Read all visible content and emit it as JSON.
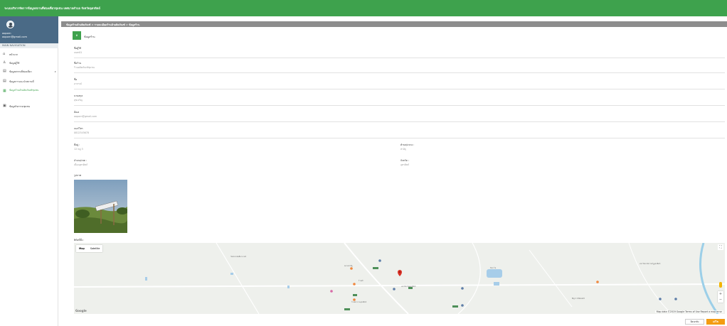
{
  "header": {
    "title": "ระบบบริหารจัดการข้อมูลสถานที่ท่องเที่ยวชุมชน เทศบาลตำบล จังหวัดอุตรดิตถ์"
  },
  "user": {
    "name": "aoporn",
    "email": "aoporn@gmail.com"
  },
  "sidebar": {
    "heading": "MAIN NAVIGATION",
    "items": [
      {
        "label": "หน้าแรก",
        "icon": "home-icon"
      },
      {
        "label": "ข้อมูลผู้ใช้",
        "icon": "user-icon"
      },
      {
        "label": "ข้อมูลสถานที่ท่องเที่ยว",
        "icon": "list-icon"
      },
      {
        "label": "ข้อมูลการแนะนำสถานที่",
        "icon": "list-icon"
      },
      {
        "label": "ข้อมูลร้านค้าผลิตภัณฑ์ชุมชน",
        "icon": "store-icon"
      },
      {
        "label": "ข้อมูลกิจกรรมชุมชน",
        "icon": "calendar-icon"
      }
    ]
  },
  "breadcrumb": "ข้อมูลร้านค้าผลิตภัณฑ์ > รายละเอียดร้านค้าผลิตภัณฑ์ > ข้อมูลร้าน",
  "panel": {
    "icon_text": "ค",
    "title": "ข้อมูลร้าน"
  },
  "fields": [
    {
      "label": "ชื่อผู้ใช้",
      "value": "user01"
    },
    {
      "label": "ชื่อร้าน",
      "value": "ร้านผลิตภัณฑ์ชุมชน"
    },
    {
      "label": "ชื่อ",
      "value": "อาภรณ์"
    },
    {
      "label": "นามสกุล",
      "value": "สุขเจริญ"
    },
    {
      "label": "อีเมล",
      "value": "aoporn@gmail.com"
    },
    {
      "label": "เบอร์โทร",
      "value": "0812345678"
    }
  ],
  "address": {
    "left": [
      {
        "label": "ที่อยู่ :",
        "value": "12 หมู่ 3"
      },
      {
        "label": "อำเภอ/เขต :",
        "value": "เมืองอุตรดิตถ์"
      }
    ],
    "right": [
      {
        "label": "ตำบล/แขวง :",
        "value": "ท่าอิฐ"
      },
      {
        "label": "จังหวัด :",
        "value": "อุตรดิตถ์"
      }
    ]
  },
  "photo_label": "รูปภาพ",
  "map": {
    "label": "พิกัดที่ตั้ง :",
    "types": [
      "Map",
      "Satellite"
    ],
    "active_type": "Map",
    "attribution": "Map data ©2019 Google  Terms of Use  Report a map error",
    "logo_text": "Google",
    "zoom_in": "+",
    "zoom_out": "−",
    "fullscreen": "⛶",
    "places": [
      "วัดพระแท่นศิลาอาสน์",
      "ตลาดท่าอิฐ",
      "สถานีรถไฟอุตรดิตถ์",
      "บึงกะโล่",
      "โรงพยาบาลอุตรดิตถ์",
      "มหาวิทยาลัยราชภัฏอุตรดิตถ์",
      "ร้านค้า",
      "Big C Uttaradit"
    ]
  },
  "buttons": {
    "back": "ย้อนกลับ",
    "save": "แก้ไข"
  },
  "colors": {
    "primary": "#3ea24d",
    "accent": "#f39c12",
    "breadcrumb": "#8d8d8d"
  }
}
